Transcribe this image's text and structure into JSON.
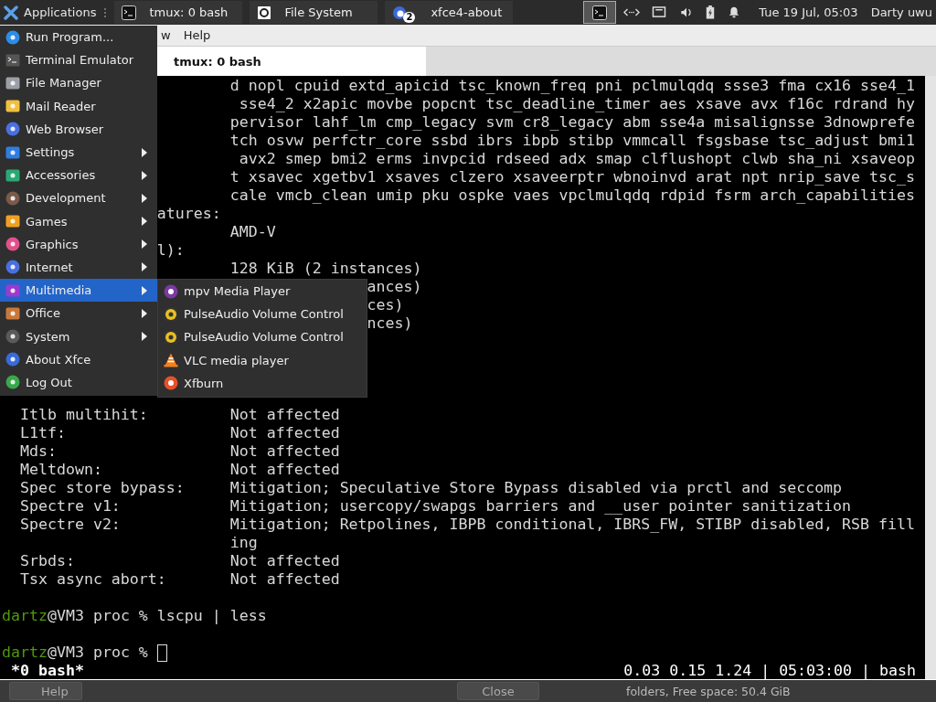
{
  "panel": {
    "apps_button": {
      "label": "Applications"
    },
    "tasks": [
      {
        "label": "tmux: 0 bash"
      },
      {
        "label": "File System"
      },
      {
        "label": "xfce4-about",
        "badge": "2"
      }
    ],
    "tray_launcher": {
      "active": true
    },
    "clock": "Tue 19 Jul, 05:03",
    "user": "Darty uwu"
  },
  "window": {
    "menubar": [
      "w",
      "Help"
    ],
    "tabs": [
      {
        "label": "tmux: 0 bash",
        "selected": true
      }
    ],
    "terminal": {
      "lines": [
        {
          "kind": "value",
          "value": "d nopl cpuid extd_apicid tsc_known_freq pni pclmulqdq ssse3 fma cx16 sse4_1"
        },
        {
          "kind": "value",
          "value": " sse4_2 x2apic movbe popcnt tsc_deadline_timer aes xsave avx f16c rdrand hy"
        },
        {
          "kind": "value",
          "value": "pervisor lahf_lm cmp_legacy svm cr8_legacy abm sse4a misalignsse 3dnowprefe"
        },
        {
          "kind": "value",
          "value": "tch osvw perfctr_core ssbd ibrs ibpb stibp vmmcall fsgsbase tsc_adjust bmi1"
        },
        {
          "kind": "value",
          "value": " avx2 smep bmi2 erms invpcid rdseed adx smap clflushopt clwb sha_ni xsaveop"
        },
        {
          "kind": "value",
          "value": "t xsavec xgetbv1 xsaves clzero xsaveerptr wbnoinvd arat npt nrip_save tsc_s"
        },
        {
          "kind": "value",
          "value": "cale vmcb_clean umip pku ospke vaes vpclmulqdq rdpid fsrm arch_capabilities"
        },
        {
          "kind": "cut",
          "value": "atures:"
        },
        {
          "kind": "value",
          "value": "AMD-V"
        },
        {
          "kind": "cut",
          "value": "l):"
        },
        {
          "kind": "value",
          "value": "128 KiB (2 instances)"
        },
        {
          "kind": "sub",
          "value": "ances)"
        },
        {
          "kind": "sub",
          "value": "ces)"
        },
        {
          "kind": "sub",
          "value": "nces)"
        },
        {
          "kind": "blank"
        },
        {
          "kind": "blank"
        },
        {
          "kind": "blank"
        },
        {
          "kind": "blank"
        },
        {
          "kind": "pair",
          "label": "Itlb multihit:",
          "value": "Not affected"
        },
        {
          "kind": "pair",
          "label": "L1tf:",
          "value": "Not affected"
        },
        {
          "kind": "pair",
          "label": "Mds:",
          "value": "Not affected"
        },
        {
          "kind": "pair",
          "label": "Meltdown:",
          "value": "Not affected"
        },
        {
          "kind": "pair",
          "label": "Spec store bypass:",
          "value": "Mitigation; Speculative Store Bypass disabled via prctl and seccomp"
        },
        {
          "kind": "pair",
          "label": "Spectre v1:",
          "value": "Mitigation; usercopy/swapgs barriers and __user pointer sanitization"
        },
        {
          "kind": "pair",
          "label": "Spectre v2:",
          "value": "Mitigation; Retpolines, IBPB conditional, IBRS_FW, STIBP disabled, RSB fill"
        },
        {
          "kind": "value",
          "value": "ing"
        },
        {
          "kind": "pair",
          "label": "Srbds:",
          "value": "Not affected"
        },
        {
          "kind": "pair",
          "label": "Tsx async abort:",
          "value": "Not affected"
        },
        {
          "kind": "blank"
        },
        {
          "kind": "prompt",
          "user": "dartz",
          "value": "@VM3 proc % lscpu | less",
          "cursor": false
        },
        {
          "kind": "blank"
        },
        {
          "kind": "prompt",
          "user": "dartz",
          "value": "@VM3 proc %",
          "cursor": true
        }
      ],
      "status": {
        "left": "*0 bash*",
        "right": "0.03 0.15 1.24 | 05:03:00 | bash"
      }
    }
  },
  "background_window": {
    "buttons": [
      "Help",
      "Close"
    ],
    "status": "folders, Free space: 50.4 GiB"
  },
  "app_menu": {
    "items": [
      {
        "label": "Run Program...",
        "submenu": false,
        "selected": false
      },
      {
        "label": "Terminal Emulator",
        "submenu": false,
        "selected": false
      },
      {
        "label": "File Manager",
        "submenu": false,
        "selected": false
      },
      {
        "label": "Mail Reader",
        "submenu": false,
        "selected": false
      },
      {
        "label": "Web Browser",
        "submenu": false,
        "selected": false
      },
      {
        "label": "Settings",
        "submenu": true,
        "selected": false
      },
      {
        "label": "Accessories",
        "submenu": true,
        "selected": false
      },
      {
        "label": "Development",
        "submenu": true,
        "selected": false
      },
      {
        "label": "Games",
        "submenu": true,
        "selected": false
      },
      {
        "label": "Graphics",
        "submenu": true,
        "selected": false
      },
      {
        "label": "Internet",
        "submenu": true,
        "selected": false
      },
      {
        "label": "Multimedia",
        "submenu": true,
        "selected": true
      },
      {
        "label": "Office",
        "submenu": true,
        "selected": false
      },
      {
        "label": "System",
        "submenu": true,
        "selected": false
      },
      {
        "label": "About Xfce",
        "submenu": false,
        "selected": false
      },
      {
        "label": "Log Out",
        "submenu": false,
        "selected": false
      }
    ]
  },
  "submenu": {
    "items": [
      {
        "label": "mpv Media Player"
      },
      {
        "label": "PulseAudio Volume Control"
      },
      {
        "label": "PulseAudio Volume Control"
      },
      {
        "label": "VLC media player"
      },
      {
        "label": "Xfburn"
      }
    ]
  }
}
